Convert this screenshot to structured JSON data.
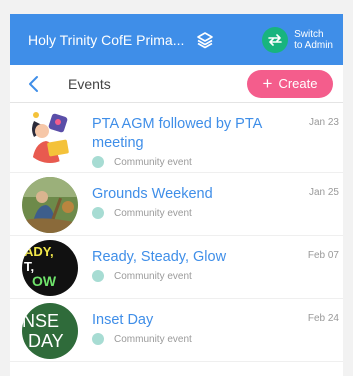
{
  "header": {
    "school_name": "Holy Trinity CofE Prima...",
    "switch_label_line1": "Switch",
    "switch_label_line2": "to Admin"
  },
  "subheader": {
    "title": "Events",
    "create_label": "Create"
  },
  "events": [
    {
      "title": "PTA AGM followed by PTA meeting",
      "type": "Community event",
      "date": "Jan 23"
    },
    {
      "title": "Grounds Weekend",
      "type": "Community event",
      "date": "Jan 25"
    },
    {
      "title": "Ready, Steady, Glow",
      "type": "Community event",
      "date": "Feb 07"
    },
    {
      "title": "Inset Day",
      "type": "Community event",
      "date": "Feb 24"
    }
  ],
  "avatar_text": {
    "glow_lines": [
      "ADY,",
      "T,",
      "OW"
    ],
    "inset_lines": [
      "NSE",
      "DAY"
    ]
  },
  "colors": {
    "header_bg": "#3f8ee8",
    "accent_pink": "#f45d8c",
    "switch_green": "#18b47e",
    "link_blue": "#3f8ee8",
    "type_dot": "#a7dcd3"
  }
}
